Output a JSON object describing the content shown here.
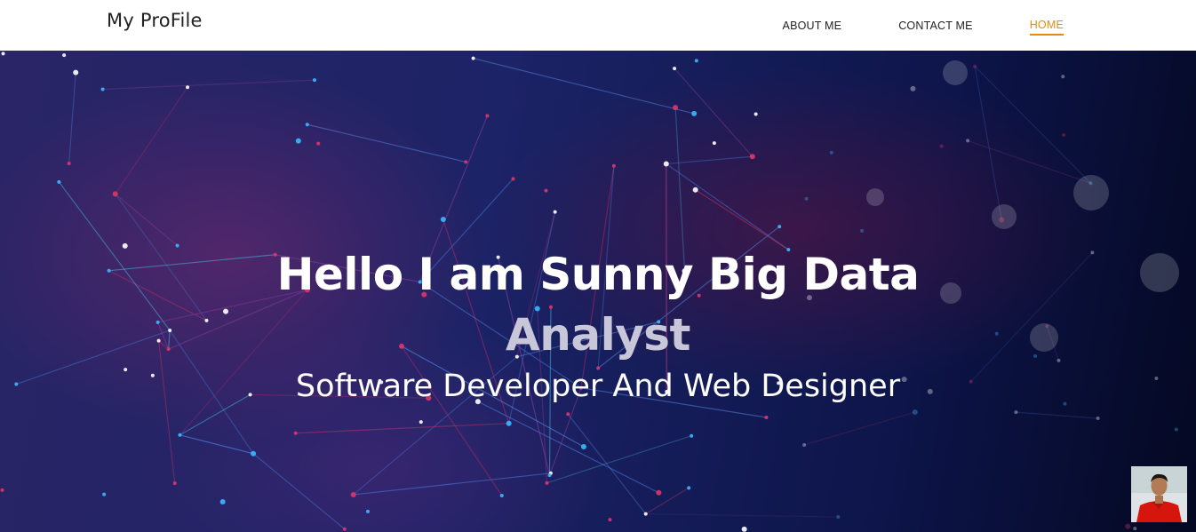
{
  "navbar": {
    "brand": "My ProFile",
    "links": [
      {
        "label": "ABOUT ME",
        "active": false
      },
      {
        "label": "CONTACT ME",
        "active": false
      },
      {
        "label": "HOME",
        "active": true
      }
    ],
    "accent_color": "#e8890c"
  },
  "hero": {
    "headline_line1": "Hello I am Sunny Big Data",
    "headline_line2": "Analyst",
    "subheadline": "Software Developer And Web Designer",
    "background": "network-lines-photo"
  },
  "avatar": {
    "icon": "profile-photo"
  }
}
